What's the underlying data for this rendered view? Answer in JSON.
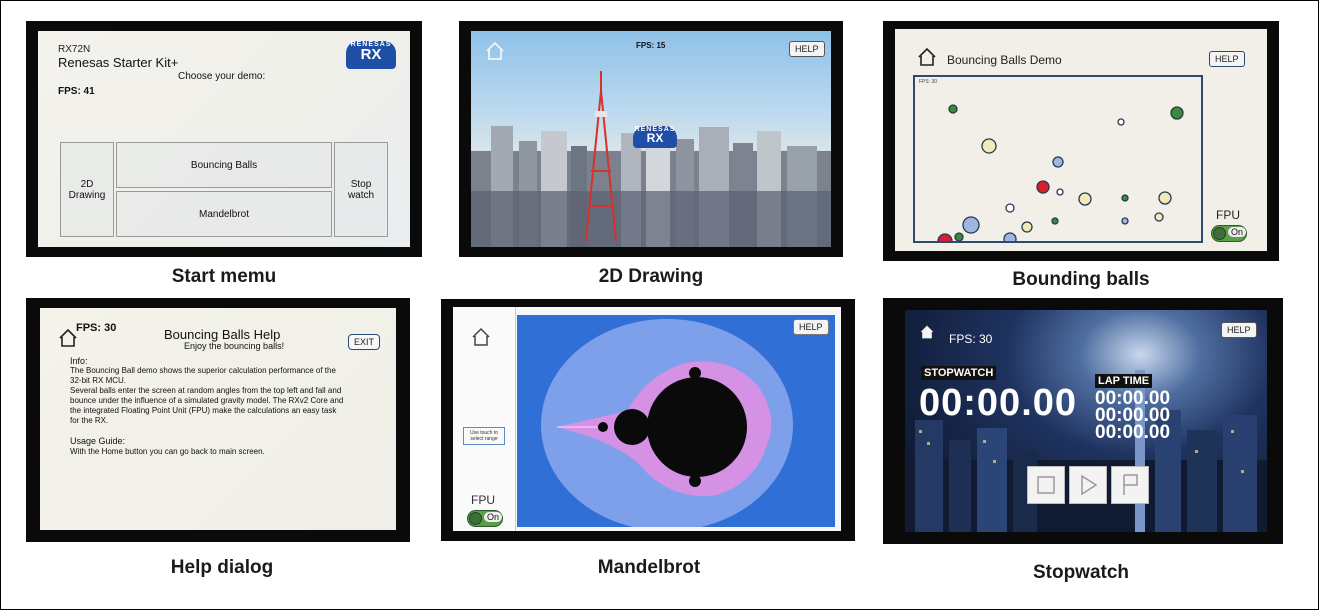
{
  "colors": {
    "bezel": "#0a0a0a",
    "brand_blue": "#1e4ea6",
    "ball_red": "#d6202a",
    "ball_green": "#3d8a3a",
    "ball_blue": "#9fb7e0",
    "ball_yellow": "#f1e9b8",
    "toggle_green": "#5a9e4a"
  },
  "captions": {
    "start": "Start memu",
    "drawing": "2D Drawing",
    "balls": "Bounding balls",
    "help": "Help dialog",
    "mandelbrot": "Mandelbrot",
    "stopwatch": "Stopwatch"
  },
  "start_menu": {
    "model": "RX72N",
    "kit": "Renesas Starter Kit+",
    "choose": "Choose your demo:",
    "fps": "FPS: 41",
    "logo_top": "RENESAS",
    "logo_bottom": "RX",
    "buttons": {
      "drawing": "2D\nDrawing",
      "balls": "Bouncing Balls",
      "mandelbrot": "Mandelbrot",
      "stopwatch": "Stop\nwatch"
    }
  },
  "drawing": {
    "fps": "FPS: 15",
    "help": "HELP",
    "logo_top": "RENESAS",
    "logo_bottom": "RX"
  },
  "balls": {
    "title": "Bouncing Balls Demo",
    "help": "HELP",
    "fps": "FPS: 30",
    "fpu": "FPU",
    "toggle": "On"
  },
  "help_dialog": {
    "fps": "FPS: 30",
    "title": "Bouncing Balls Help",
    "subtitle": "Enjoy the bouncing balls!",
    "exit": "EXIT",
    "info_heading": "Info:",
    "info_lines": [
      "The Bouncing Ball demo shows the superior calculation performance of the",
      "32-bit RX MCU.",
      "Several balls enter the screen at random angles from the top left and fall and",
      "bounce under the influence of a simulated gravity model. The RXv2 Core and",
      "the integrated Floating Point Unit (FPU) make the calculations an easy task",
      "for the RX."
    ],
    "usage_heading": "Usage Guide:",
    "usage_line": "With the Home button you can go back to main screen."
  },
  "mandelbrot": {
    "help": "HELP",
    "hint": "Use touch to select range",
    "fpu": "FPU",
    "toggle": "On"
  },
  "stopwatch": {
    "fps": "FPS: 30",
    "help": "HELP",
    "stopwatch_label": "STOPWATCH",
    "laptime_label": "LAP TIME",
    "time": "00:00.00",
    "laps": [
      "00:00.00",
      "00:00.00",
      "00:00.00"
    ]
  }
}
